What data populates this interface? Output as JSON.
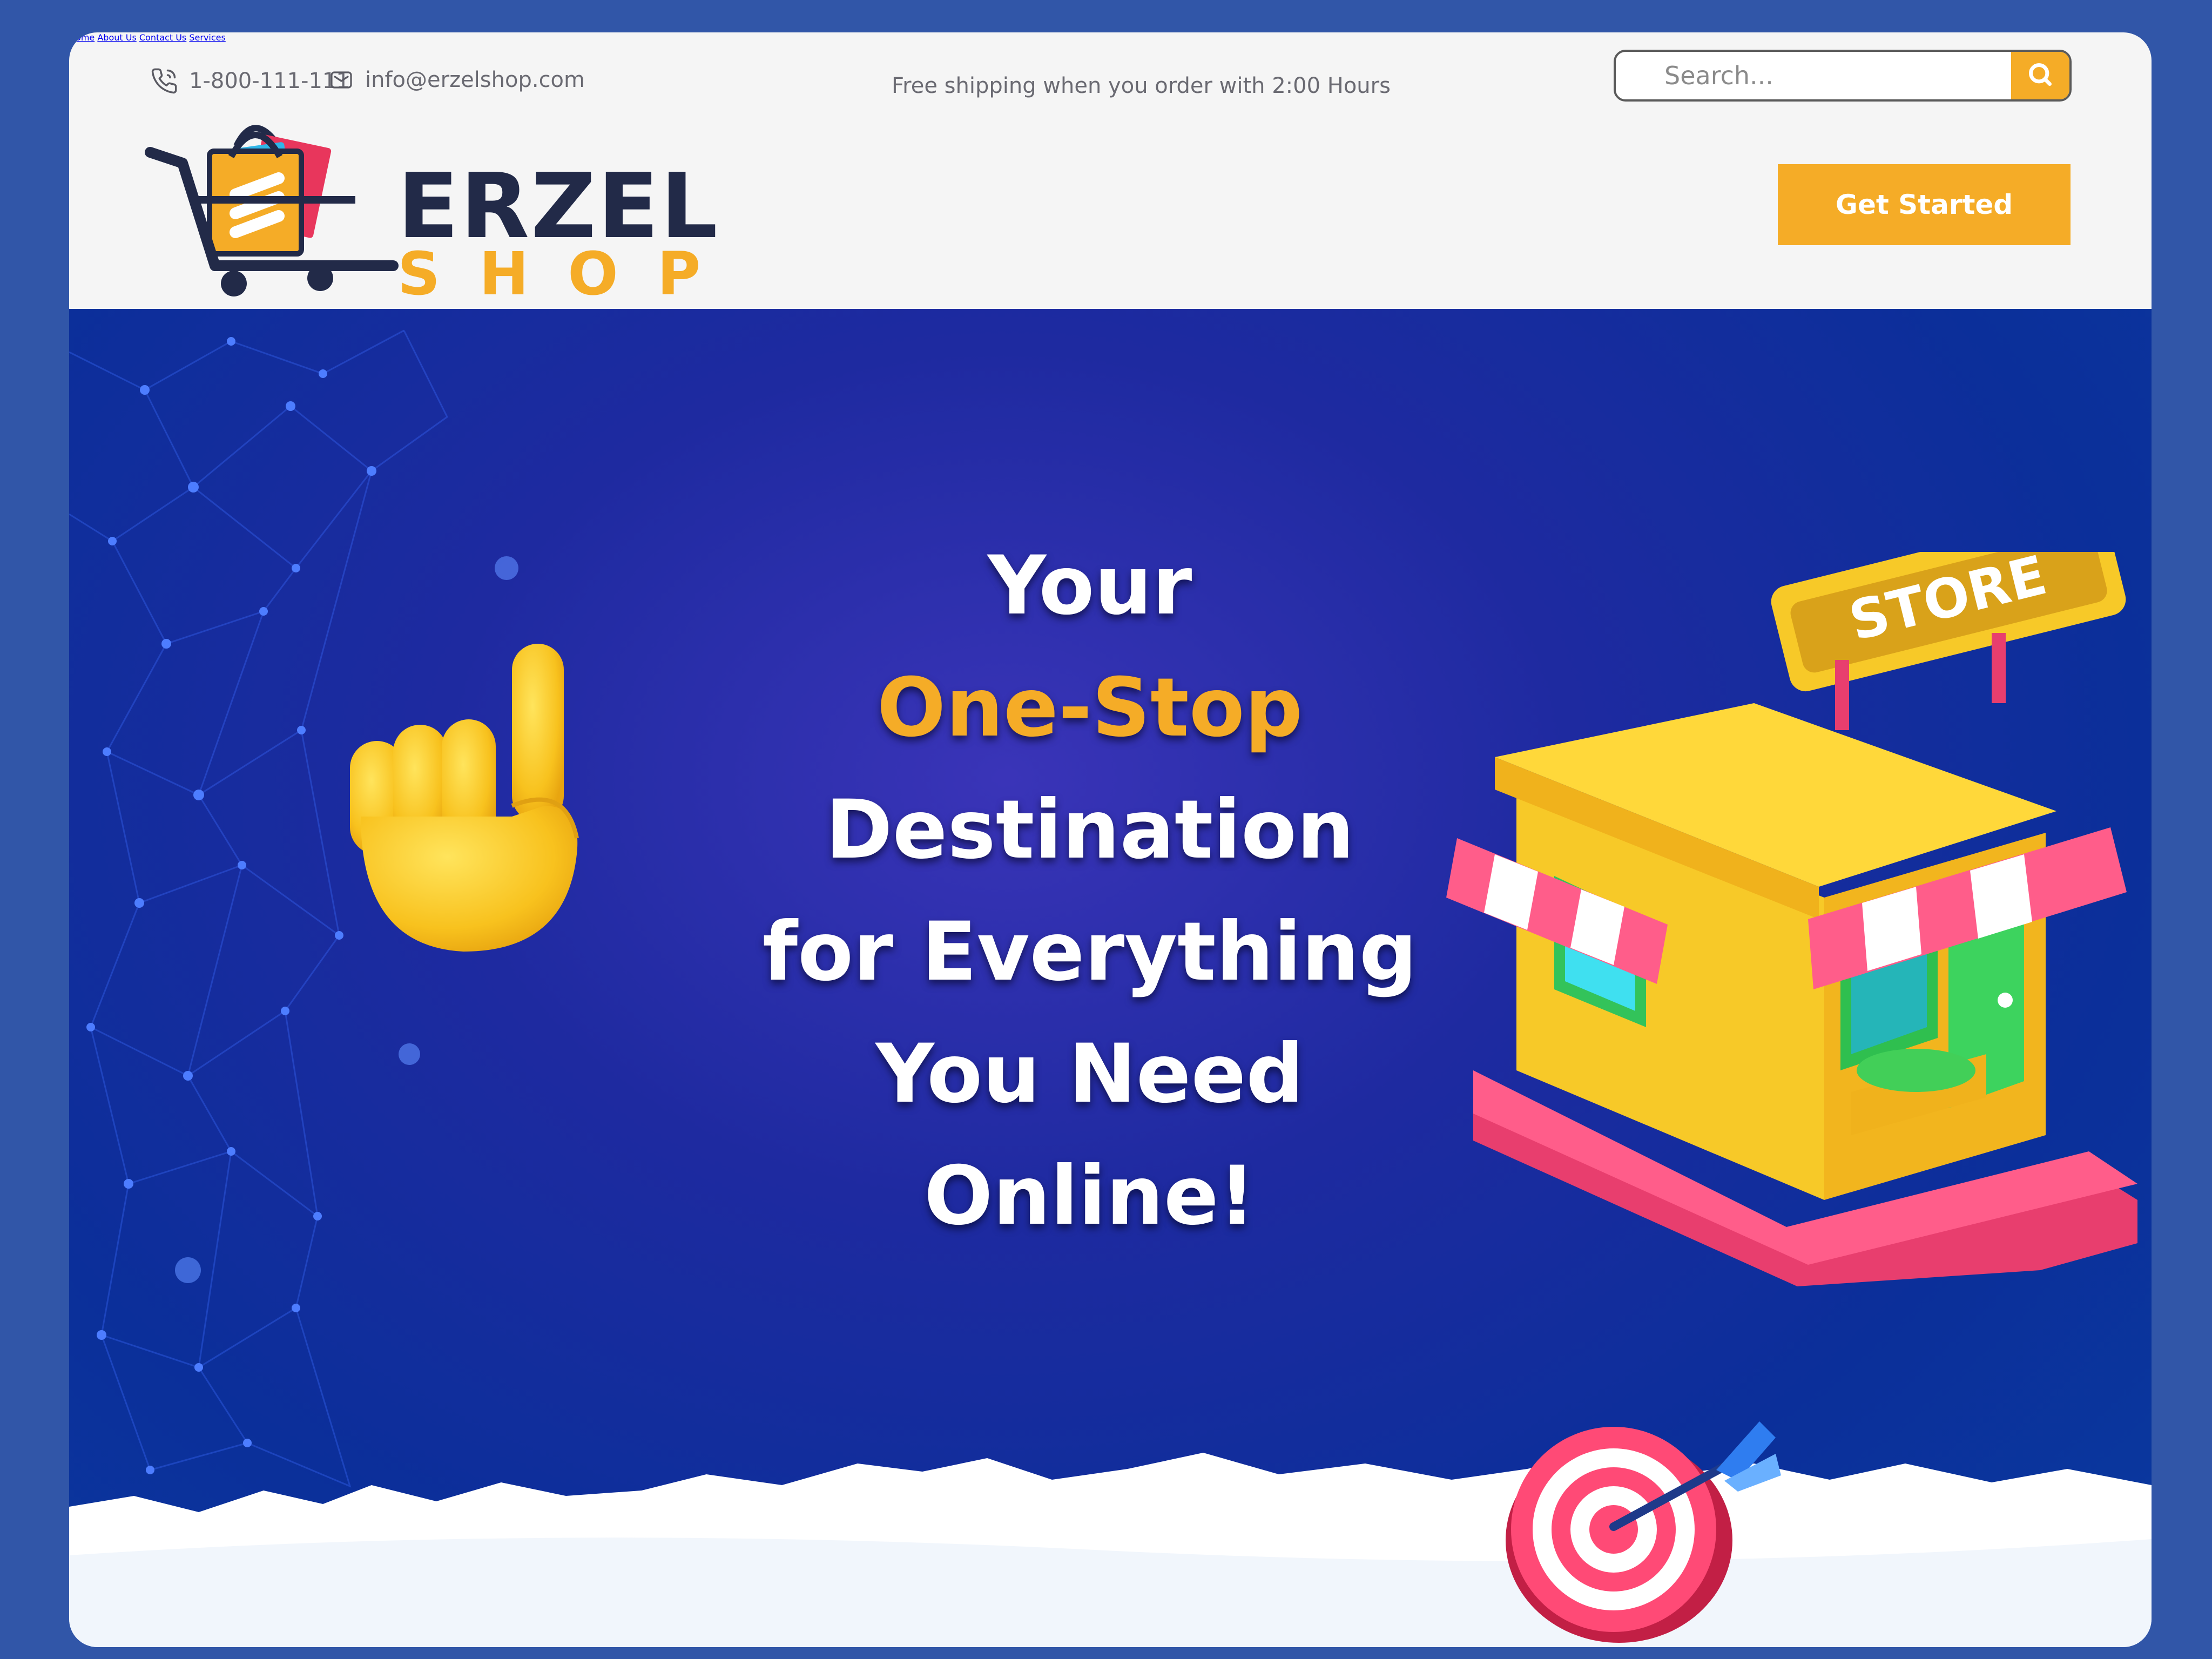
{
  "topbar": {
    "phone": "1-800-111-111",
    "email": "info@erzelshop.com",
    "shipping_note": "Free shipping when you order with 2:00 Hours",
    "search_placeholder": "Search..."
  },
  "logo": {
    "line1": "ERZEL",
    "line2": "SHOP"
  },
  "nav": {
    "items": [
      {
        "label": "Home"
      },
      {
        "label": "About Us"
      },
      {
        "label": "Contact Us"
      },
      {
        "label": "Services"
      }
    ],
    "cta_label": "Get Started"
  },
  "hero": {
    "line1": "Your",
    "line2": "One-Stop",
    "line3": "Destination",
    "line4": "for Everything",
    "line5": "You Need",
    "line6": "Online!",
    "store_sign": "STORE"
  },
  "colors": {
    "accent": "#f5ac27",
    "brand_dark": "#222a48",
    "hero_blue": "#0a2a8f",
    "page_background": "#3156a8"
  },
  "icons": [
    "phone-icon",
    "mail-icon",
    "search-icon",
    "shopping-cart-icon",
    "pointing-hand-icon",
    "store-icon",
    "target-icon"
  ]
}
